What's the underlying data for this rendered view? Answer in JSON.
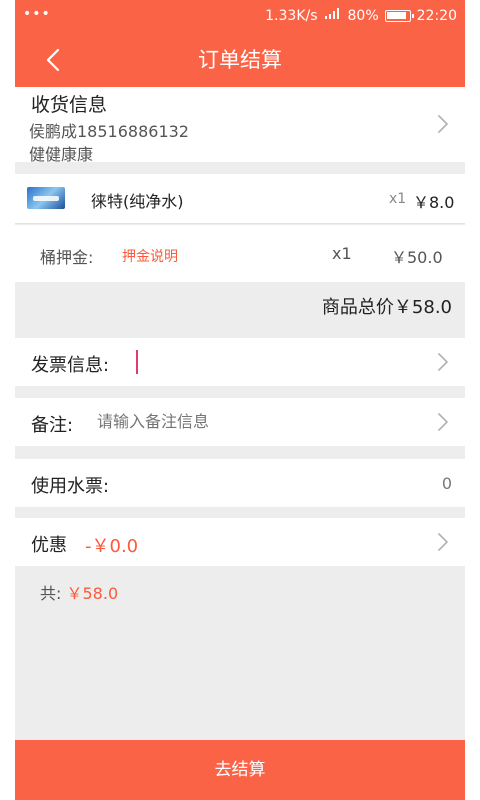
{
  "status_bar": {
    "dots": "•••",
    "net_speed": "1.33K/s",
    "battery": "80%",
    "time": "22:20"
  },
  "header": {
    "title": "订单结算",
    "back_icon": "chevron-left-icon"
  },
  "address": {
    "section_title": "收货信息",
    "contact": "侯鹏成18516886132",
    "address_line": "健健康康"
  },
  "product": {
    "name": "徕特(纯净水)",
    "qty": "x1",
    "price": "￥8.0"
  },
  "deposit": {
    "label": "桶押金:",
    "link": "押金说明",
    "qty": "x1",
    "price": "￥50.0"
  },
  "goods_total": "商品总价￥58.0",
  "invoice": {
    "label": "发票信息:"
  },
  "remark": {
    "label": "备注:",
    "placeholder": "请输入备注信息"
  },
  "water_ticket": {
    "label": "使用水票:",
    "value": "0"
  },
  "discount": {
    "label": "优惠",
    "value": "-￥0.0"
  },
  "summary": {
    "label": "共:",
    "amount": "￥58.0"
  },
  "checkout_button": "去结算",
  "colors": {
    "brand": "#fb6346",
    "accent_text": "#fb5a3c"
  }
}
